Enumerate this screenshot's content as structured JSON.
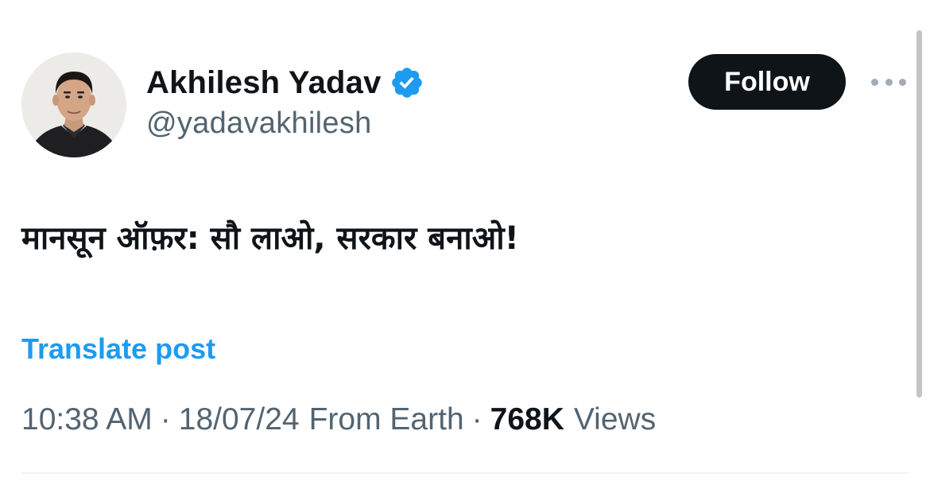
{
  "author": {
    "display_name": "Akhilesh Yadav",
    "handle": "@yadavakhilesh",
    "verified": true,
    "avatar_icon": "profile-photo"
  },
  "actions": {
    "follow_label": "Follow",
    "more_icon": "more-horizontal-icon"
  },
  "post": {
    "text": "मानसून ऑफ़र: सौ लाओ, सरकार बनाओ!",
    "translate_label": "Translate post"
  },
  "meta": {
    "time": "10:38 AM",
    "date": "18/07/24",
    "source": "From Earth",
    "separator": "·",
    "views_count": "768K",
    "views_label": "Views"
  },
  "colors": {
    "text_primary": "#0f1419",
    "text_secondary": "#536471",
    "link_blue": "#1d9bf0",
    "button_dark": "#0f1419"
  }
}
